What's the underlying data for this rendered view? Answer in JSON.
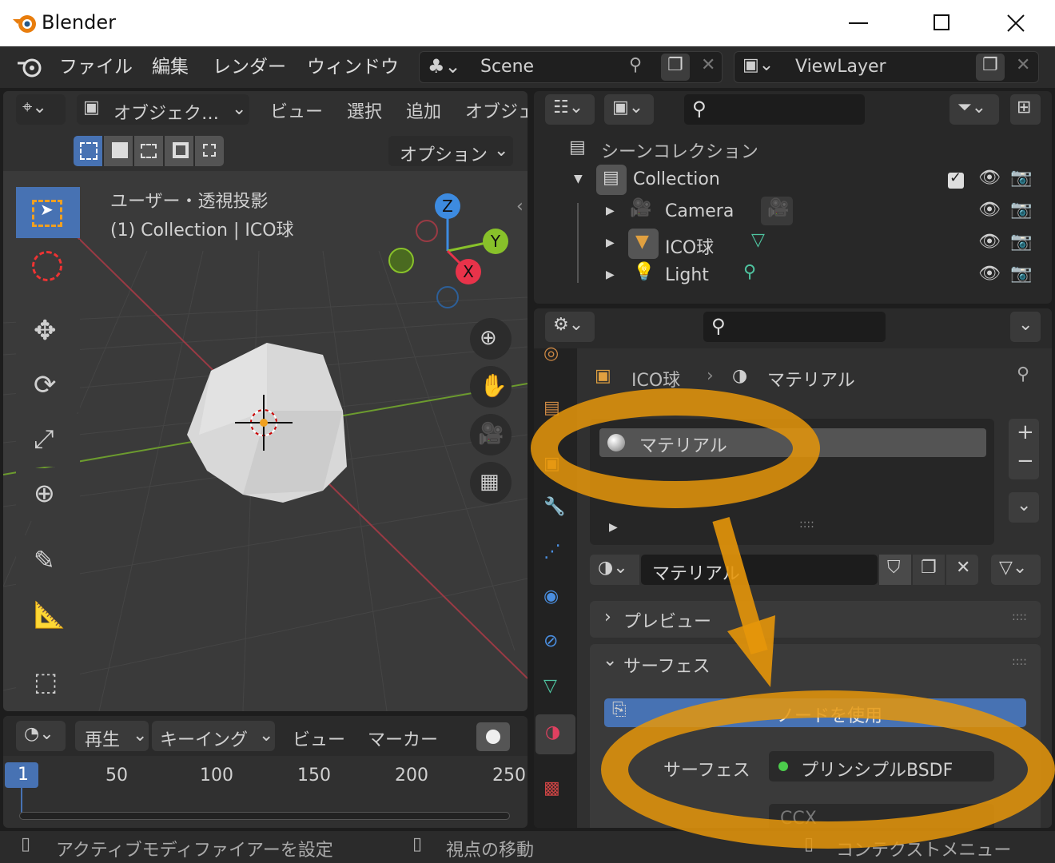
{
  "window": {
    "title": "Blender"
  },
  "menus": [
    "ファイル",
    "編集",
    "レンダー",
    "ウィンドウ"
  ],
  "scene": {
    "name": "Scene"
  },
  "view_layer": {
    "name": "ViewLayer"
  },
  "viewport": {
    "mode": "オブジェク…",
    "menus": [
      "ビュー",
      "選択",
      "追加",
      "オブジェ"
    ],
    "options": "オプション",
    "view_name": "ユーザー・透視投影",
    "view_sub": "(1) Collection | ICO球",
    "axes": {
      "z": "Z",
      "y": "Y",
      "x": "X"
    }
  },
  "outliner": {
    "scene_collection": "シーンコレクション",
    "items": [
      {
        "label": "Collection"
      },
      {
        "label": "Camera"
      },
      {
        "label": "ICO球"
      },
      {
        "label": "Light"
      }
    ]
  },
  "properties": {
    "breadcrumb_object": "ICO球",
    "breadcrumb_material": "マテリアル",
    "slot": "マテリアル",
    "material_name": "マテリアル",
    "panel_preview": "プレビュー",
    "panel_surface": "サーフェス",
    "use_nodes": "ノードを使用",
    "surface_label": "サーフェス",
    "surface_value": "プリンシプルBSDF",
    "cut_text": "CCX"
  },
  "timeline": {
    "menus": [
      "再生",
      "キーイング",
      "ビュー",
      "マーカー"
    ],
    "current_frame": "1",
    "ticks": [
      "50",
      "100",
      "150",
      "200",
      "250"
    ]
  },
  "status": {
    "left": "アクティブモディファイアーを設定",
    "mid": "視点の移動",
    "right": "コンテクストメニュー"
  },
  "colors": {
    "accent": "#4772b3",
    "annotation": "#e6960a",
    "axis_x": "#e8334a",
    "axis_y": "#88c12a",
    "axis_z": "#3d8be0"
  }
}
